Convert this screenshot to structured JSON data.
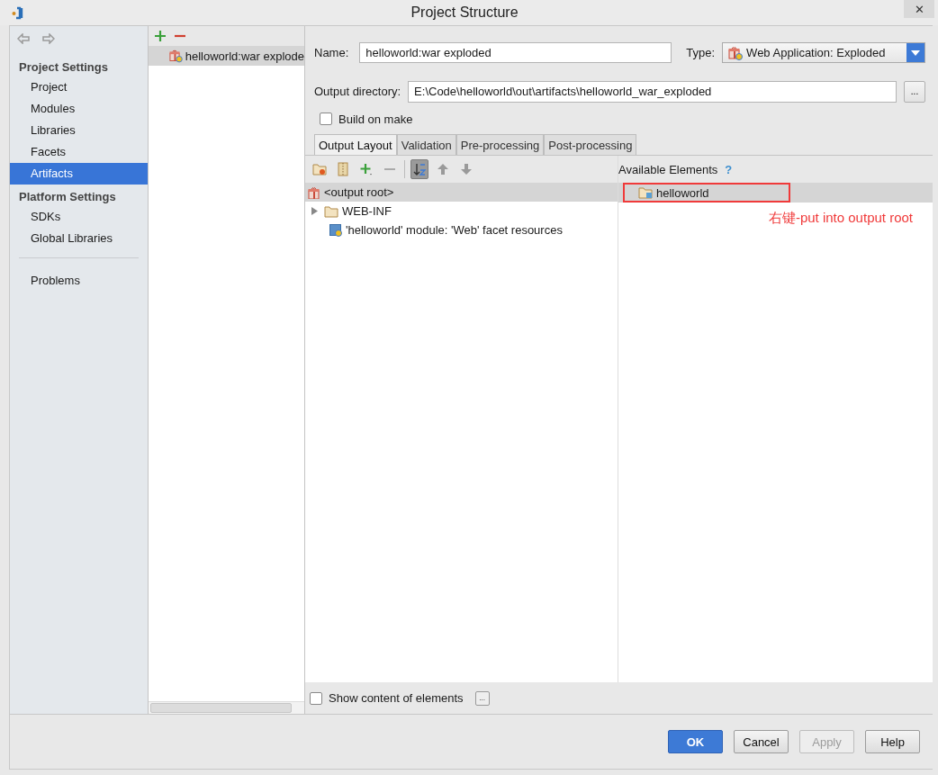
{
  "window": {
    "title": "Project Structure",
    "close": "✕"
  },
  "sidebar": {
    "sections": [
      {
        "title": "Project Settings",
        "items": [
          {
            "label": "Project",
            "selected": false
          },
          {
            "label": "Modules",
            "selected": false
          },
          {
            "label": "Libraries",
            "selected": false
          },
          {
            "label": "Facets",
            "selected": false
          },
          {
            "label": "Artifacts",
            "selected": true
          }
        ]
      },
      {
        "title": "Platform Settings",
        "items": [
          {
            "label": "SDKs",
            "selected": false
          },
          {
            "label": "Global Libraries",
            "selected": false
          }
        ]
      }
    ],
    "extra_items": [
      {
        "label": "Problems",
        "selected": false
      }
    ]
  },
  "artifacts": {
    "items": [
      {
        "label": "helloworld:war explode",
        "selected": true
      }
    ]
  },
  "form": {
    "name_label": "Name:",
    "name_value": "helloworld:war exploded",
    "type_label": "Type:",
    "type_value": "Web Application: Exploded",
    "output_label": "Output directory:",
    "output_value": "E:\\Code\\helloworld\\out\\artifacts\\helloworld_war_exploded",
    "browse": "...",
    "build_on_make": {
      "label": "Build on make",
      "checked": false
    }
  },
  "tabs": [
    {
      "label": "Output Layout",
      "selected": true
    },
    {
      "label": "Validation",
      "selected": false
    },
    {
      "label": "Pre-processing",
      "selected": false
    },
    {
      "label": "Post-processing",
      "selected": false
    }
  ],
  "toolbar": [
    {
      "kind": "new-folder",
      "on": false
    },
    {
      "kind": "archive",
      "on": false
    },
    {
      "kind": "add",
      "on": false
    },
    {
      "kind": "remove",
      "on": false
    },
    {
      "kind": "sort",
      "on": true
    },
    {
      "kind": "up",
      "on": false
    },
    {
      "kind": "down",
      "on": false
    }
  ],
  "layout_tree": [
    {
      "label": "<output root>",
      "kind": "root",
      "selected": true
    },
    {
      "label": "WEB-INF",
      "kind": "folder",
      "expanded": false,
      "selected": false
    },
    {
      "label": "'helloworld' module: 'Web' facet resources",
      "kind": "module",
      "selected": false
    }
  ],
  "available": {
    "title": "Available Elements",
    "help": "?",
    "items": [
      {
        "label": "helloworld",
        "selected": true,
        "highlighted": true
      }
    ]
  },
  "annotation": "右键-put into output root",
  "show_content": {
    "label": "Show content of elements",
    "checked": false,
    "more": "..."
  },
  "buttons": [
    {
      "label": "OK",
      "kind": "default"
    },
    {
      "label": "Cancel",
      "kind": "normal"
    },
    {
      "label": "Apply",
      "kind": "disabled"
    },
    {
      "label": "Help",
      "kind": "normal"
    }
  ]
}
